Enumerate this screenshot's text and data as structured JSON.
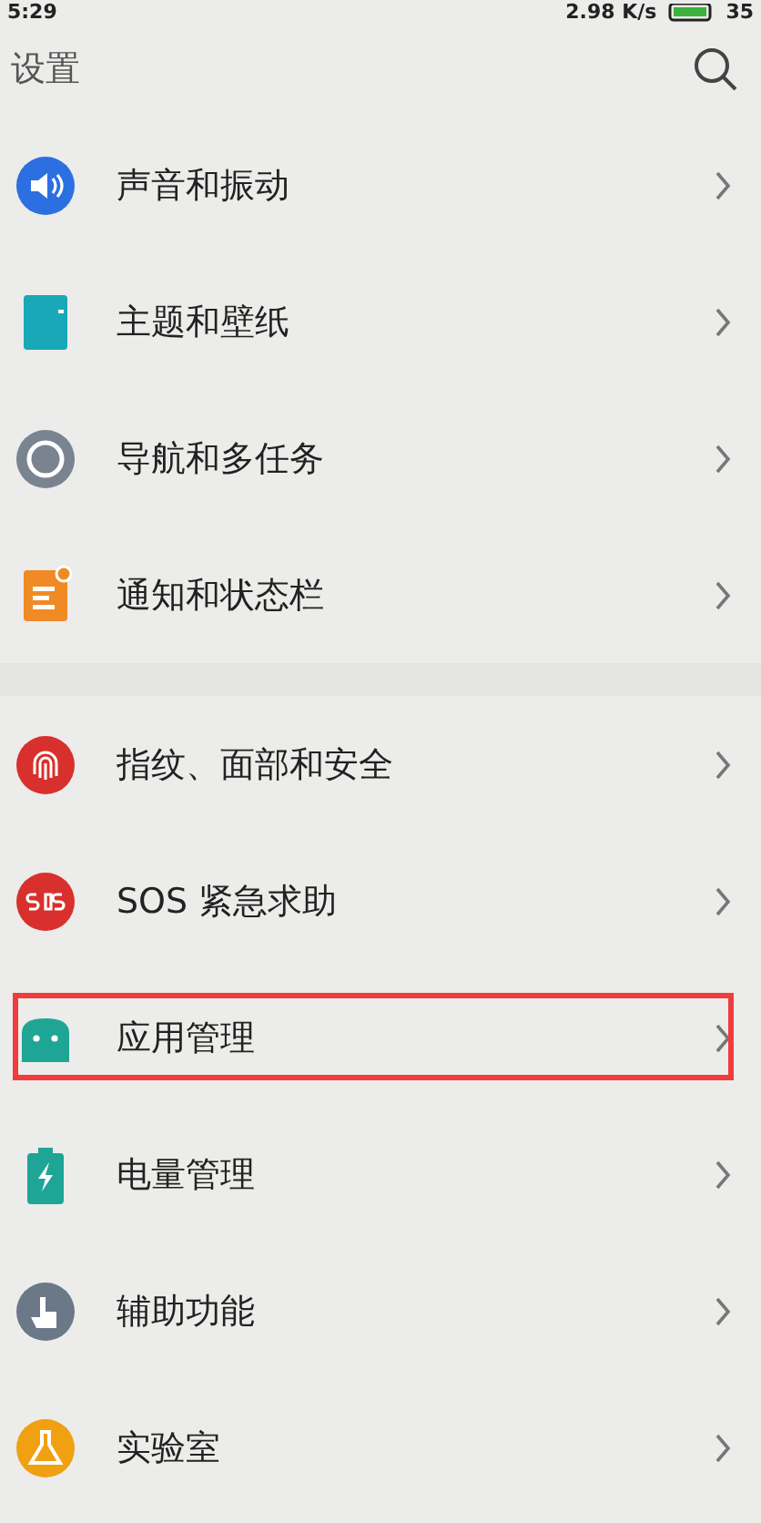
{
  "status_bar": {
    "time": "5:29",
    "speed": "2.98 K/s",
    "battery": "35"
  },
  "header": {
    "title": "设置"
  },
  "groups": [
    {
      "items": [
        {
          "label": "声音和振动",
          "kind": "sound",
          "color": "#2c6fe0",
          "highlighted": false
        },
        {
          "label": "主题和壁纸",
          "kind": "theme",
          "color": "#18a8b8",
          "highlighted": false
        },
        {
          "label": "导航和多任务",
          "kind": "nav",
          "color": "#7a8490",
          "highlighted": false
        },
        {
          "label": "通知和状态栏",
          "kind": "notify",
          "color": "#f08a24",
          "highlighted": false
        }
      ]
    },
    {
      "items": [
        {
          "label": "指纹、面部和安全",
          "kind": "finger",
          "color": "#d8302c",
          "highlighted": false
        },
        {
          "label": "SOS 紧急求助",
          "kind": "sos",
          "color": "#d8302c",
          "highlighted": false
        },
        {
          "label": "应用管理",
          "kind": "app",
          "color": "#1ea595",
          "highlighted": true
        },
        {
          "label": "电量管理",
          "kind": "battery",
          "color": "#1ea595",
          "highlighted": false
        },
        {
          "label": "辅助功能",
          "kind": "assist",
          "color": "#6a7888",
          "highlighted": false
        },
        {
          "label": "实验室",
          "kind": "lab",
          "color": "#f0a010",
          "highlighted": false
        }
      ]
    }
  ]
}
